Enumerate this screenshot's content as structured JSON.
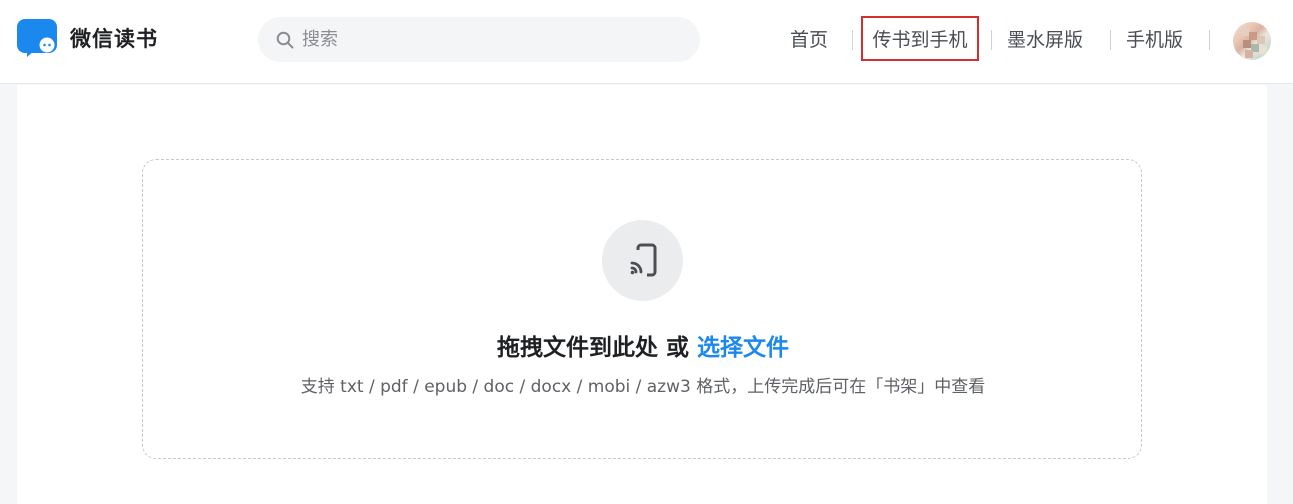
{
  "header": {
    "logo_text": "微信读书",
    "logo_icon": "chat-bubble-book-icon",
    "search": {
      "placeholder": "搜索",
      "value": "",
      "icon": "search-icon"
    },
    "nav": {
      "home": "首页",
      "transfer": "传书到手机",
      "eink": "墨水屏版",
      "mobile": "手机版"
    },
    "avatar_icon": "user-avatar"
  },
  "upload": {
    "icon": "cast-to-phone-icon",
    "title_prefix": "拖拽文件到此处 或 ",
    "title_link": "选择文件",
    "hint": "支持 txt / pdf / epub / doc / docx / mobi / azw3 格式，上传完成后可在「书架」中查看"
  },
  "colors": {
    "brand": "#1b88ee",
    "highlight_border": "#d32f2f"
  }
}
